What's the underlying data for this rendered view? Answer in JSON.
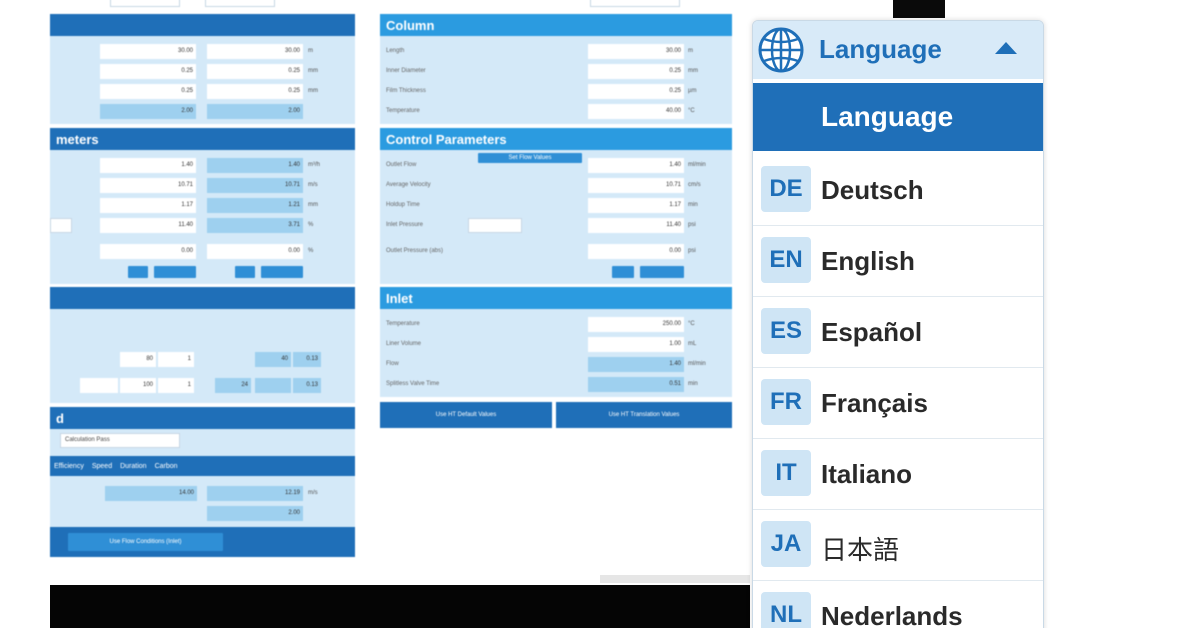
{
  "app": {
    "left": {
      "sections": [
        {
          "title": ""
        },
        {
          "title": "meters"
        },
        {
          "title": ""
        },
        {
          "title": "d"
        }
      ],
      "top_values": [
        {
          "a": "30.00",
          "b": "30.00",
          "unit": "m"
        },
        {
          "a": "0.25",
          "b": "0.25",
          "unit": "mm"
        },
        {
          "a": "0.25",
          "b": "0.25",
          "unit": "mm"
        },
        {
          "a": "2.00",
          "b": "2.00",
          "unit": ""
        }
      ],
      "param_values": [
        {
          "a": "1.40",
          "b": "1.40",
          "unit": "m³/h"
        },
        {
          "a": "10.71",
          "b": "10.71",
          "unit": "m/s"
        },
        {
          "a": "1.17",
          "b": "1.21",
          "unit": "mm"
        },
        {
          "a": "11.40",
          "b": "3.71",
          "unit": "%"
        },
        {
          "a": "0.00",
          "b": "0.00",
          "unit": "%"
        }
      ],
      "table_values": [
        {
          "a": "80",
          "b": "1",
          "c": "40",
          "d": "0.13"
        },
        {
          "a": "100",
          "b": "1",
          "c": "24",
          "d": "0.13"
        }
      ],
      "select_value": "Calculation Pass",
      "radio_options": [
        "Efficiency",
        "Speed",
        "Duration",
        "Carbon"
      ],
      "result_values": [
        {
          "a": "14.00",
          "b": "12.19",
          "unit": "m/s"
        },
        {
          "a": "",
          "b": "2.00",
          "unit": ""
        }
      ],
      "bottom_button": "Use Flow Conditions (Inlet)"
    },
    "right": {
      "col_header": "Column",
      "col_rows": [
        {
          "label": "Length",
          "value": "30.00",
          "unit": "m"
        },
        {
          "label": "Inner Diameter",
          "value": "0.25",
          "unit": "mm"
        },
        {
          "label": "Film Thickness",
          "value": "0.25",
          "unit": "µm"
        },
        {
          "label": "Temperature",
          "value": "40.00",
          "unit": "°C"
        }
      ],
      "ctrl_header": "Control Parameters",
      "ctrl_button": "Set Flow Values",
      "ctrl_rows": [
        {
          "label": "Outlet Flow",
          "value": "1.40",
          "unit": "ml/min"
        },
        {
          "label": "Average Velocity",
          "value": "10.71",
          "unit": "cm/s"
        },
        {
          "label": "Holdup Time",
          "value": "1.17",
          "unit": "min"
        },
        {
          "label": "Inlet Pressure",
          "value": "11.40",
          "unit": "psi"
        },
        {
          "label": "Outlet Pressure (abs)",
          "value": "0.00",
          "unit": "psi"
        }
      ],
      "inlet_header": "Inlet",
      "inlet_rows": [
        {
          "label": "Temperature",
          "value": "250.00",
          "unit": "°C"
        },
        {
          "label": "Liner Volume",
          "value": "1.00",
          "unit": "mL"
        },
        {
          "label": "Flow",
          "value": "1.40",
          "unit": "ml/min"
        },
        {
          "label": "Splitless Valve Time",
          "value": "0.51",
          "unit": "min"
        }
      ],
      "btn_default": "Use HT Default Values",
      "btn_translate": "Use HT Translation Values"
    }
  },
  "language_menu": {
    "header_label": "Language",
    "selected_label": "Language",
    "items": [
      {
        "code": "DE",
        "name": "Deutsch"
      },
      {
        "code": "EN",
        "name": "English"
      },
      {
        "code": "ES",
        "name": "Español"
      },
      {
        "code": "FR",
        "name": "Français"
      },
      {
        "code": "IT",
        "name": "Italiano"
      },
      {
        "code": "JA",
        "name": "日本語"
      },
      {
        "code": "NL",
        "name": "Nederlands"
      }
    ]
  },
  "colors": {
    "primary": "#1f6fb8",
    "accent": "#2b9be0",
    "panel": "#d4e9f8",
    "value_fill": "#9ed0ef"
  }
}
